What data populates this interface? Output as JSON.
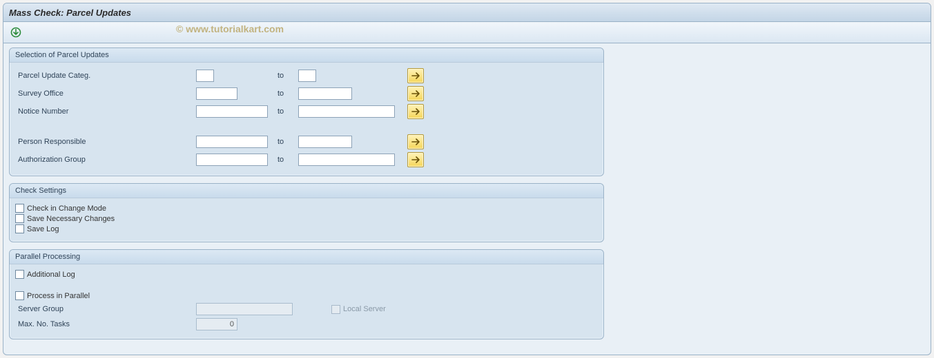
{
  "header": {
    "title": "Mass Check: Parcel Updates"
  },
  "watermark": "© www.tutorialkart.com",
  "groups": {
    "selection": {
      "title": "Selection of Parcel Updates",
      "to_label": "to",
      "rows": {
        "categ": {
          "label": "Parcel Update Categ.",
          "from": "",
          "to": ""
        },
        "survey": {
          "label": "Survey Office",
          "from": "",
          "to": ""
        },
        "notice": {
          "label": "Notice Number",
          "from": "",
          "to": ""
        },
        "person": {
          "label": "Person Responsible",
          "from": "",
          "to": ""
        },
        "auth": {
          "label": "Authorization Group",
          "from": "",
          "to": ""
        }
      }
    },
    "check": {
      "title": "Check Settings",
      "items": {
        "change_mode": {
          "label": "Check in Change Mode",
          "checked": false
        },
        "save_changes": {
          "label": "Save Necessary Changes",
          "checked": false
        },
        "save_log": {
          "label": "Save Log",
          "checked": false
        }
      }
    },
    "parallel": {
      "title": "Parallel Processing",
      "items": {
        "add_log": {
          "label": "Additional Log",
          "checked": false
        },
        "in_par": {
          "label": "Process in Parallel",
          "checked": false
        },
        "local_srv": {
          "label": "Local Server",
          "checked": false,
          "disabled": true
        }
      },
      "fields": {
        "server_group": {
          "label": "Server Group",
          "value": ""
        },
        "max_tasks": {
          "label": "Max. No. Tasks",
          "value": "0"
        }
      }
    }
  }
}
